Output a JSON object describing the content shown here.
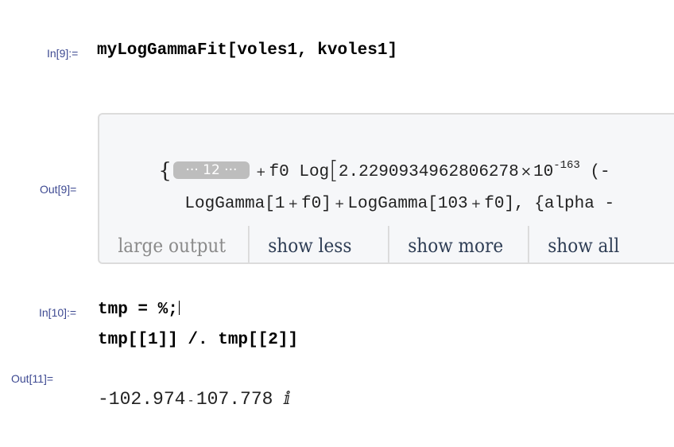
{
  "cells": {
    "in9": {
      "label": "In[9]:=",
      "code": "myLogGammaFit[voles1, kvoles1]"
    },
    "out9": {
      "label": "Out[9]=",
      "line1": {
        "open_brace": "{",
        "elided_count": "··· 12 ···",
        "plus1": "+",
        "term1": "f0 Log",
        "open_bracket": "[",
        "number": "2.2290934962806278",
        "times": "×",
        "base": "10",
        "exponent": "-163",
        "tail": " (-"
      },
      "line2": {
        "part1": "LogGamma[1",
        "plus_a": "+",
        "part2": "f0]",
        "plus_b": "+",
        "part3": "LogGamma[103",
        "plus_c": "+",
        "part4": "f0], {alpha -"
      },
      "large_output_bar": {
        "label": "large output",
        "buttons": [
          {
            "label": "show less"
          },
          {
            "label": "show more"
          },
          {
            "label": "show all"
          }
        ]
      }
    },
    "in10": {
      "label": "In[10]:=",
      "line1": "tmp = %;",
      "line2": "tmp[[1]] /. tmp[[2]]"
    },
    "out11": {
      "label": "Out[11]=",
      "result_real": "-102.974",
      "minus": "-",
      "result_imag": "107.778",
      "imag_unit": "ⅈ"
    }
  },
  "colors": {
    "label": "#3e4a92",
    "output_box_bg": "#f6f7f9",
    "output_box_border": "#dcdcdc",
    "elided_bg": "#bdbdbd",
    "button_text": "#2f3e55",
    "large_output_text": "#8a8a8a"
  }
}
